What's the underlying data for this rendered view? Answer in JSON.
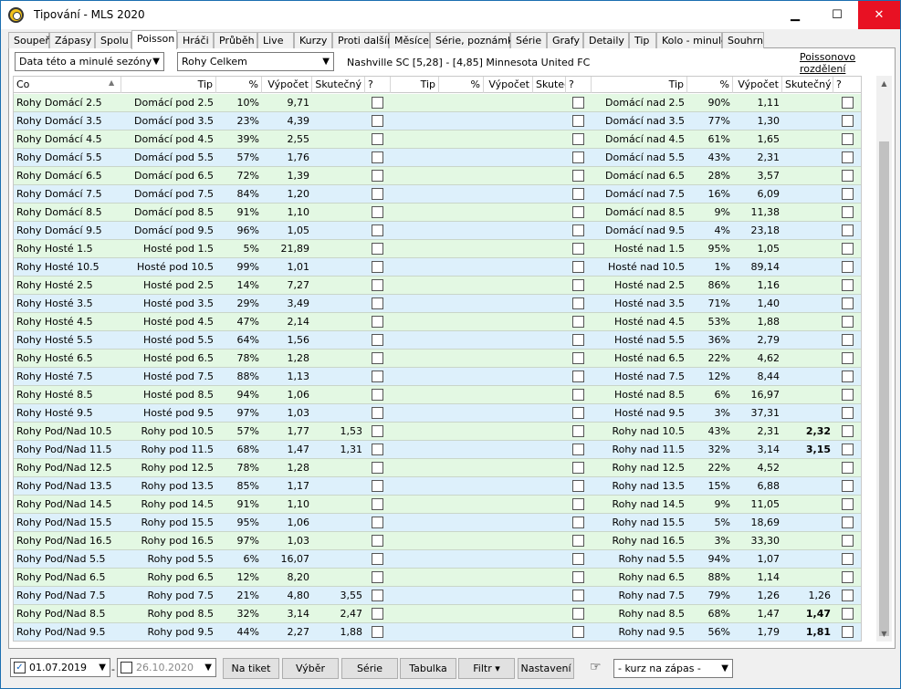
{
  "window": {
    "title": "Tipování - MLS 2020",
    "min": "▁",
    "max": "☐",
    "close": "✕"
  },
  "tabs": [
    "Soupeři",
    "Zápasy",
    "Spolu",
    "Poisson",
    "Hráči",
    "Průběh",
    "Live",
    "Kurzy",
    "Proti dalším",
    "Měsíce",
    "Série, poznámky",
    "Série",
    "Grafy",
    "Detaily",
    "Tip",
    "Kolo - minulé",
    "Souhrn"
  ],
  "active_tab": "Poisson",
  "filters": {
    "season": "Data této a minulé sezóny",
    "market": "Rohy Celkem",
    "match": "Nashville SC [5,28] - [4,85] Minnesota United FC",
    "poisson_link": "Poissonovo rozdělení"
  },
  "columns": [
    "Co",
    "Tip",
    "%",
    "Výpočet",
    "Skutečný",
    "?",
    "Tip",
    "%",
    "Výpočet",
    "Skuteč",
    "?",
    "Tip",
    "%",
    "Výpočet",
    "Skutečný",
    "?"
  ],
  "rows": [
    {
      "co": "Rohy Domácí 2.5",
      "tip": "Domácí pod 2.5",
      "p": "10%",
      "v": "9,71",
      "s": "",
      "tip2": "Domácí nad 2.5",
      "p2": "90%",
      "v2": "1,11",
      "s2": ""
    },
    {
      "co": "Rohy Domácí 3.5",
      "tip": "Domácí pod 3.5",
      "p": "23%",
      "v": "4,39",
      "s": "",
      "tip2": "Domácí nad 3.5",
      "p2": "77%",
      "v2": "1,30",
      "s2": ""
    },
    {
      "co": "Rohy Domácí 4.5",
      "tip": "Domácí pod 4.5",
      "p": "39%",
      "v": "2,55",
      "s": "",
      "tip2": "Domácí nad 4.5",
      "p2": "61%",
      "v2": "1,65",
      "s2": ""
    },
    {
      "co": "Rohy Domácí 5.5",
      "tip": "Domácí pod 5.5",
      "p": "57%",
      "v": "1,76",
      "s": "",
      "tip2": "Domácí nad 5.5",
      "p2": "43%",
      "v2": "2,31",
      "s2": ""
    },
    {
      "co": "Rohy Domácí 6.5",
      "tip": "Domácí pod 6.5",
      "p": "72%",
      "v": "1,39",
      "s": "",
      "tip2": "Domácí nad 6.5",
      "p2": "28%",
      "v2": "3,57",
      "s2": ""
    },
    {
      "co": "Rohy Domácí 7.5",
      "tip": "Domácí pod 7.5",
      "p": "84%",
      "v": "1,20",
      "s": "",
      "tip2": "Domácí nad 7.5",
      "p2": "16%",
      "v2": "6,09",
      "s2": ""
    },
    {
      "co": "Rohy Domácí 8.5",
      "tip": "Domácí pod 8.5",
      "p": "91%",
      "v": "1,10",
      "s": "",
      "tip2": "Domácí nad 8.5",
      "p2": "9%",
      "v2": "11,38",
      "s2": ""
    },
    {
      "co": "Rohy Domácí 9.5",
      "tip": "Domácí pod 9.5",
      "p": "96%",
      "v": "1,05",
      "s": "",
      "tip2": "Domácí nad 9.5",
      "p2": "4%",
      "v2": "23,18",
      "s2": ""
    },
    {
      "co": "Rohy Hosté 1.5",
      "tip": "Hosté pod 1.5",
      "p": "5%",
      "v": "21,89",
      "s": "",
      "tip2": "Hosté nad 1.5",
      "p2": "95%",
      "v2": "1,05",
      "s2": ""
    },
    {
      "co": "Rohy Hosté 10.5",
      "tip": "Hosté pod 10.5",
      "p": "99%",
      "v": "1,01",
      "s": "",
      "tip2": "Hosté nad 10.5",
      "p2": "1%",
      "v2": "89,14",
      "s2": ""
    },
    {
      "co": "Rohy Hosté 2.5",
      "tip": "Hosté pod 2.5",
      "p": "14%",
      "v": "7,27",
      "s": "",
      "tip2": "Hosté nad 2.5",
      "p2": "86%",
      "v2": "1,16",
      "s2": ""
    },
    {
      "co": "Rohy Hosté 3.5",
      "tip": "Hosté pod 3.5",
      "p": "29%",
      "v": "3,49",
      "s": "",
      "tip2": "Hosté nad 3.5",
      "p2": "71%",
      "v2": "1,40",
      "s2": ""
    },
    {
      "co": "Rohy Hosté 4.5",
      "tip": "Hosté pod 4.5",
      "p": "47%",
      "v": "2,14",
      "s": "",
      "tip2": "Hosté nad 4.5",
      "p2": "53%",
      "v2": "1,88",
      "s2": ""
    },
    {
      "co": "Rohy Hosté 5.5",
      "tip": "Hosté pod 5.5",
      "p": "64%",
      "v": "1,56",
      "s": "",
      "tip2": "Hosté nad 5.5",
      "p2": "36%",
      "v2": "2,79",
      "s2": ""
    },
    {
      "co": "Rohy Hosté 6.5",
      "tip": "Hosté pod 6.5",
      "p": "78%",
      "v": "1,28",
      "s": "",
      "tip2": "Hosté nad 6.5",
      "p2": "22%",
      "v2": "4,62",
      "s2": ""
    },
    {
      "co": "Rohy Hosté 7.5",
      "tip": "Hosté pod 7.5",
      "p": "88%",
      "v": "1,13",
      "s": "",
      "tip2": "Hosté nad 7.5",
      "p2": "12%",
      "v2": "8,44",
      "s2": ""
    },
    {
      "co": "Rohy Hosté 8.5",
      "tip": "Hosté pod 8.5",
      "p": "94%",
      "v": "1,06",
      "s": "",
      "tip2": "Hosté nad 8.5",
      "p2": "6%",
      "v2": "16,97",
      "s2": ""
    },
    {
      "co": "Rohy Hosté 9.5",
      "tip": "Hosté pod 9.5",
      "p": "97%",
      "v": "1,03",
      "s": "",
      "tip2": "Hosté nad 9.5",
      "p2": "3%",
      "v2": "37,31",
      "s2": ""
    },
    {
      "co": "Rohy Pod/Nad 10.5",
      "tip": "Rohy pod 10.5",
      "p": "57%",
      "v": "1,77",
      "s": "1,53",
      "tip2": "Rohy nad 10.5",
      "p2": "43%",
      "v2": "2,31",
      "s2": "2,32",
      "b2": true
    },
    {
      "co": "Rohy Pod/Nad 11.5",
      "tip": "Rohy pod 11.5",
      "p": "68%",
      "v": "1,47",
      "s": "1,31",
      "tip2": "Rohy nad 11.5",
      "p2": "32%",
      "v2": "3,14",
      "s2": "3,15",
      "b2": true
    },
    {
      "co": "Rohy Pod/Nad 12.5",
      "tip": "Rohy pod 12.5",
      "p": "78%",
      "v": "1,28",
      "s": "",
      "tip2": "Rohy nad 12.5",
      "p2": "22%",
      "v2": "4,52",
      "s2": ""
    },
    {
      "co": "Rohy Pod/Nad 13.5",
      "tip": "Rohy pod 13.5",
      "p": "85%",
      "v": "1,17",
      "s": "",
      "tip2": "Rohy nad 13.5",
      "p2": "15%",
      "v2": "6,88",
      "s2": ""
    },
    {
      "co": "Rohy Pod/Nad 14.5",
      "tip": "Rohy pod 14.5",
      "p": "91%",
      "v": "1,10",
      "s": "",
      "tip2": "Rohy nad 14.5",
      "p2": "9%",
      "v2": "11,05",
      "s2": ""
    },
    {
      "co": "Rohy Pod/Nad 15.5",
      "tip": "Rohy pod 15.5",
      "p": "95%",
      "v": "1,06",
      "s": "",
      "tip2": "Rohy nad 15.5",
      "p2": "5%",
      "v2": "18,69",
      "s2": ""
    },
    {
      "co": "Rohy Pod/Nad 16.5",
      "tip": "Rohy pod 16.5",
      "p": "97%",
      "v": "1,03",
      "s": "",
      "tip2": "Rohy nad 16.5",
      "p2": "3%",
      "v2": "33,30",
      "s2": ""
    },
    {
      "co": "Rohy Pod/Nad 5.5",
      "tip": "Rohy pod 5.5",
      "p": "6%",
      "v": "16,07",
      "s": "",
      "tip2": "Rohy nad 5.5",
      "p2": "94%",
      "v2": "1,07",
      "s2": ""
    },
    {
      "co": "Rohy Pod/Nad 6.5",
      "tip": "Rohy pod 6.5",
      "p": "12%",
      "v": "8,20",
      "s": "",
      "tip2": "Rohy nad 6.5",
      "p2": "88%",
      "v2": "1,14",
      "s2": ""
    },
    {
      "co": "Rohy Pod/Nad 7.5",
      "tip": "Rohy pod 7.5",
      "p": "21%",
      "v": "4,80",
      "s": "3,55",
      "tip2": "Rohy nad 7.5",
      "p2": "79%",
      "v2": "1,26",
      "s2": "1,26"
    },
    {
      "co": "Rohy Pod/Nad 8.5",
      "tip": "Rohy pod 8.5",
      "p": "32%",
      "v": "3,14",
      "s": "2,47",
      "tip2": "Rohy nad 8.5",
      "p2": "68%",
      "v2": "1,47",
      "s2": "1,47",
      "b2": true
    },
    {
      "co": "Rohy Pod/Nad 9.5",
      "tip": "Rohy pod 9.5",
      "p": "44%",
      "v": "2,27",
      "s": "1,88",
      "tip2": "Rohy nad 9.5",
      "p2": "56%",
      "v2": "1,79",
      "s2": "1,81",
      "b2": true
    }
  ],
  "bottom": {
    "date_from": "01.07.2019",
    "date_to": "26.10.2020",
    "dash": "-",
    "buttons": [
      "Na tiket",
      "Výběr",
      "Série",
      "Tabulka",
      "Filtr ▾",
      "Nastavení"
    ],
    "kurz": "- kurz na zápas -"
  }
}
